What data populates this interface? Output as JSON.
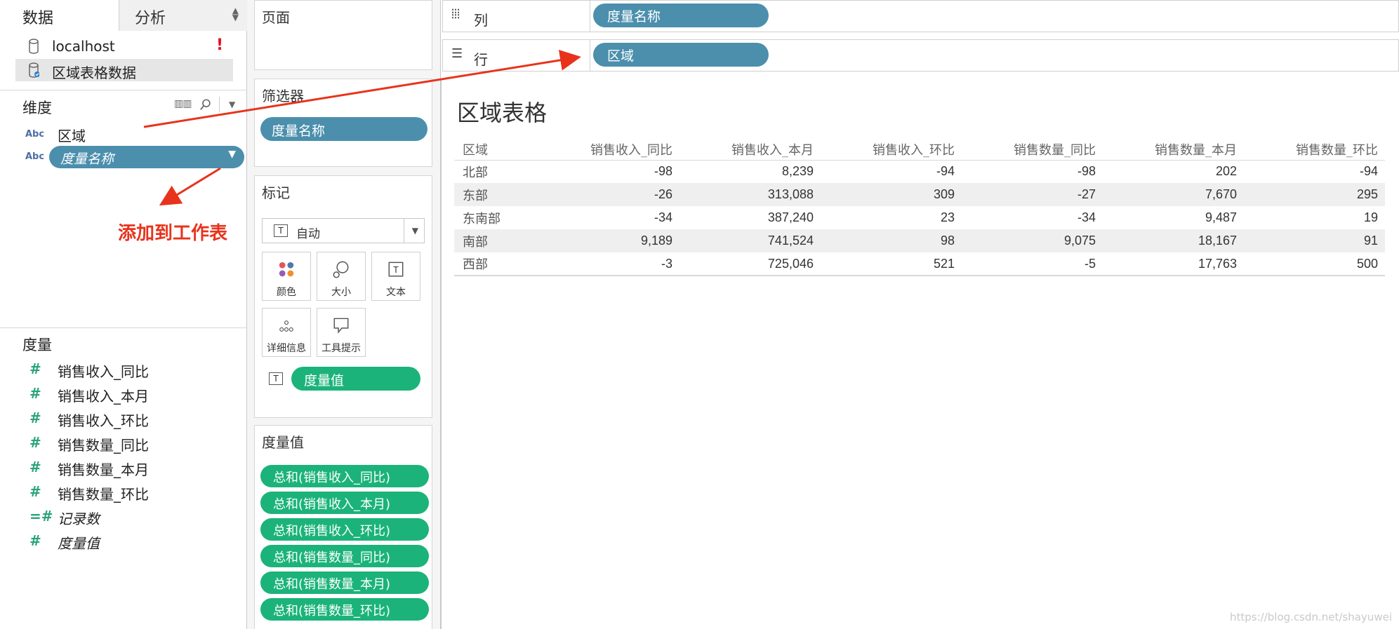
{
  "data_pane": {
    "tabs": [
      "数据",
      "分析"
    ],
    "datasources": [
      "localhost",
      "区域表格数据"
    ],
    "warning": "!",
    "dimensions_header": "维度",
    "dimensions": [
      {
        "type": "Abc",
        "label": "区域"
      },
      {
        "type": "Abc",
        "label": "度量名称"
      }
    ],
    "measures_header": "度量",
    "measures": [
      "销售收入_同比",
      "销售收入_本月",
      "销售收入_环比",
      "销售数量_同比",
      "销售数量_本月",
      "销售数量_环比",
      "记录数",
      "度量值"
    ],
    "annotation": "添加到工作表"
  },
  "shelves": {
    "pages_title": "页面",
    "filters_title": "筛选器",
    "filter_pill": "度量名称",
    "marks_title": "标记",
    "mark_type": "自动",
    "mark_buttons": [
      "颜色",
      "大小",
      "文本",
      "详细信息",
      "工具提示"
    ],
    "marks_value_pill": "度量值",
    "measure_values_title": "度量值",
    "measure_values": [
      "总和(销售收入_同比)",
      "总和(销售收入_本月)",
      "总和(销售收入_环比)",
      "总和(销售数量_同比)",
      "总和(销售数量_本月)",
      "总和(销售数量_环比)"
    ]
  },
  "top_shelves": {
    "columns_label": "列",
    "columns_pill": "度量名称",
    "rows_label": "行",
    "rows_pill": "区域"
  },
  "view": {
    "title": "区域表格",
    "columns": [
      "区域",
      "销售收入_同比",
      "销售收入_本月",
      "销售收入_环比",
      "销售数量_同比",
      "销售数量_本月",
      "销售数量_环比"
    ],
    "rows": [
      [
        "北部",
        "-98",
        "8,239",
        "-94",
        "-98",
        "202",
        "-94"
      ],
      [
        "东部",
        "-26",
        "313,088",
        "309",
        "-27",
        "7,670",
        "295"
      ],
      [
        "东南部",
        "-34",
        "387,240",
        "23",
        "-34",
        "9,487",
        "19"
      ],
      [
        "南部",
        "9,189",
        "741,524",
        "98",
        "9,075",
        "18,167",
        "91"
      ],
      [
        "西部",
        "-3",
        "725,046",
        "521",
        "-5",
        "17,763",
        "500"
      ]
    ]
  },
  "watermark": "https://blog.csdn.net/shayuwei",
  "colors": {
    "dimension_pill": "#4b8fad",
    "measure_pill": "#1bb37a",
    "annotation": "#e8331c",
    "warning": "#e0141e"
  }
}
